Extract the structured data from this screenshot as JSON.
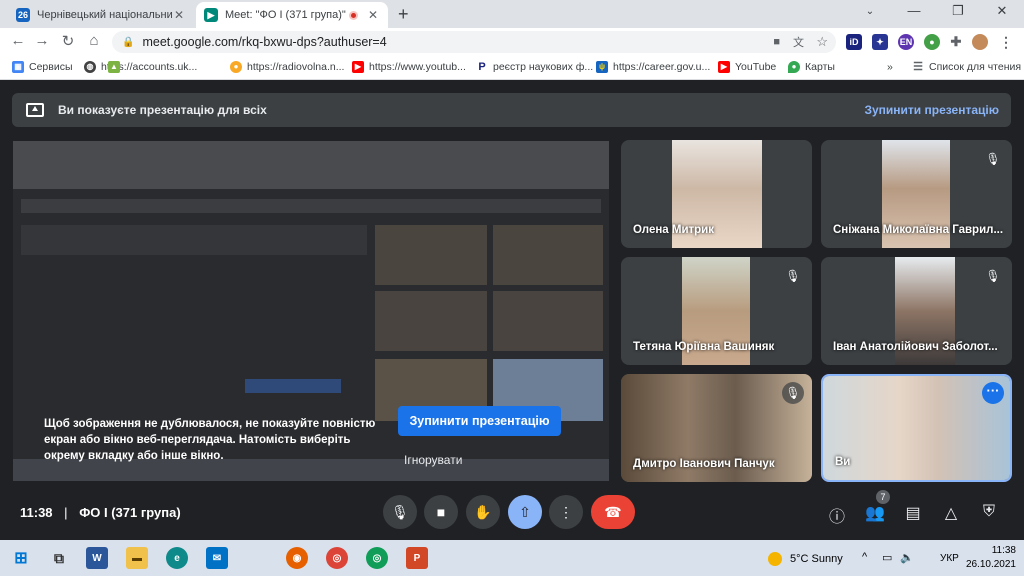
{
  "browser": {
    "tabs": [
      {
        "title": "Чернівецький національний ун",
        "active": false
      },
      {
        "title": "Meet: \"ФО І (371 група)\"",
        "active": true
      }
    ],
    "url": "meet.google.com/rkq-bxwu-dps?authuser=4",
    "bookmarks": [
      {
        "label": "Сервисы"
      },
      {
        "label": "https://accounts.uk..."
      },
      {
        "label": "https://radiovolna.n..."
      },
      {
        "label": "https://www.youtub..."
      },
      {
        "label": "реєстр наукових ф..."
      },
      {
        "label": "https://career.gov.u..."
      },
      {
        "label": "YouTube"
      },
      {
        "label": "Карты"
      }
    ],
    "more_bookmarks": "»",
    "reading_list": "Список для чтения"
  },
  "meet": {
    "banner_text": "Ви показуєте презентацію для всіх",
    "banner_stop": "Зупинити презентацію",
    "warning": "Щоб зображення не дублювалося, не показуйте повністю екран або вікно веб-переглядача. Натомість виберіть окрему вкладку або інше вікно.",
    "stop_button": "Зупинити презентацію",
    "ignore_button": "Ігнорувати",
    "participants": [
      {
        "name": "Олена Митрик",
        "muted": false
      },
      {
        "name": "Сніжана Миколаївна Гаврил...",
        "muted": true
      },
      {
        "name": "Тетяна Юріївна Вашиняк",
        "muted": true
      },
      {
        "name": "Іван Анатолійович Заболот...",
        "muted": true
      },
      {
        "name": "Дмитро Іванович Панчук",
        "muted": true
      },
      {
        "name": "Ви",
        "muted": false
      }
    ],
    "meeting_time": "11:38",
    "separator": "|",
    "meeting_name": "ФО І (371 група)",
    "participant_count": "7"
  },
  "taskbar": {
    "weather": "5°C  Sunny",
    "language": "УКР",
    "time": "11:38",
    "date": "26.10.2021"
  },
  "colors": {
    "accent": "#1a73e8",
    "hangup": "#ea4335",
    "banner_link": "#8ab4f8"
  }
}
